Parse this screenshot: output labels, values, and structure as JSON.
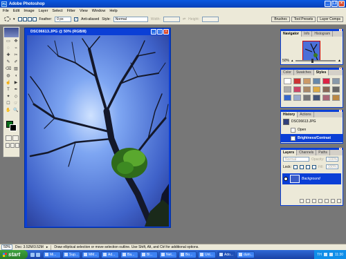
{
  "app": {
    "title": "Adobe Photoshop"
  },
  "menu": [
    "File",
    "Edit",
    "Image",
    "Layer",
    "Select",
    "Filter",
    "View",
    "Window",
    "Help"
  ],
  "options": {
    "feather_label": "Feather:",
    "feather_value": "0 px",
    "antialiased_label": "Anti-aliased",
    "style_label": "Style:",
    "style_value": "Normal",
    "width_label": "Width:",
    "height_label": "Height:",
    "wells": [
      "Brushes",
      "Tool Presets",
      "Layer Comps"
    ]
  },
  "toolbox": {
    "tools": [
      "▭",
      "✥",
      "◌",
      "⌁",
      "✚",
      "✂",
      "✎",
      "✐",
      "⌫",
      "▨",
      "◍",
      "◖",
      "☝",
      "▶",
      "T",
      "✒",
      "✦",
      "◇",
      "☐",
      "☞",
      "✋",
      "🔍"
    ],
    "foreground_color": "#0a6c1a",
    "background_color": "#000000"
  },
  "document": {
    "title": "DSC06613.JPG @ 50% (RGB/8)"
  },
  "navigator": {
    "tabs": [
      "Navigator",
      "Info",
      "Histogram"
    ],
    "zoom": "50%"
  },
  "styles": {
    "tabs": [
      "Color",
      "Swatches",
      "Styles"
    ],
    "swatches": [
      "#ffffff",
      "#cc3333",
      "#cc9966",
      "#6688aa",
      "#dd2244",
      "#8899aa",
      "#aaaaaa",
      "#cc4466",
      "#aa8866",
      "#ddaa44",
      "#886655",
      "#666666",
      "#3366cc",
      "#99aacc",
      "#777777",
      "#445577",
      "#aa6677",
      "#bb8844"
    ]
  },
  "history": {
    "tabs": [
      "History",
      "Actions"
    ],
    "snapshot": "DSC06613.JPG",
    "items": [
      "Open",
      "Brightness/Contrast"
    ]
  },
  "layers": {
    "tabs": [
      "Layers",
      "Channels",
      "Paths"
    ],
    "blend_mode": "Normal",
    "opacity_label": "Opacity:",
    "opacity_value": "100%",
    "lock_label": "Lock:",
    "fill_label": "Fill:",
    "fill_value": "100%",
    "layer_name": "Background"
  },
  "status": {
    "zoom": "50%",
    "doc_size": "Doc: 3.52M/3.52M",
    "hint": "Draw elliptical selection or move selection outline. Use Shift, Alt, and Ctrl for additional options."
  },
  "taskbar": {
    "start": "start",
    "tasks": [
      "Mi...",
      "Sup...",
      "MM...",
      "Ad...",
      "Ba...",
      "Bl...",
      "Net...",
      "Bo...",
      "Unt...",
      "Ado...",
      "dum..."
    ],
    "active_index": 9,
    "lang": "TH",
    "clock": "11:30"
  }
}
